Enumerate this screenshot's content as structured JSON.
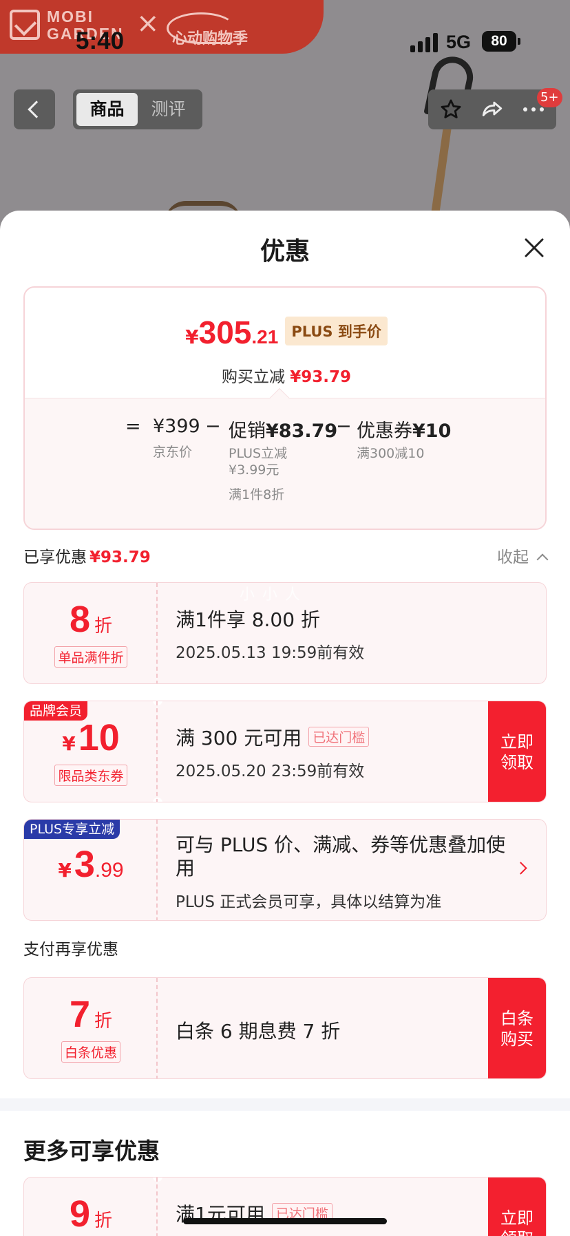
{
  "status_bar": {
    "time": "5:40",
    "network": "5G",
    "battery": "80"
  },
  "brand": {
    "name_line1": "MOBI",
    "name_line2": "GARDEN",
    "cross": "×",
    "campaign": "心动购物季"
  },
  "nav": {
    "tabs": [
      "商品",
      "测评"
    ],
    "active_tab": "商品",
    "badge": "5+"
  },
  "sheet": {
    "title": "优惠",
    "summary": {
      "currency": "¥",
      "price_int": "305",
      "price_dec": ".21",
      "price_tag": "PLUS 到手价",
      "reduce_label": "购买立减",
      "reduce_amount": "¥93.79",
      "eq": "=",
      "minus": "−",
      "jd_price": "¥399",
      "jd_price_label": "京东价",
      "promo_label": "促销",
      "promo_amount": "¥83.79",
      "promo_sub1": "PLUS立减",
      "promo_sub2": "¥3.99元",
      "promo_sub3": "满1件8折",
      "coupon_label": "优惠券",
      "coupon_amount": "¥10",
      "coupon_sub": "满300减10"
    },
    "enjoyed": {
      "label": "已享优惠",
      "amount": "¥93.79",
      "collapse_label": "收起"
    },
    "watermark": "小 小 人",
    "offers": [
      {
        "big": "8",
        "unit": "折",
        "tag": "单品满件折",
        "title": "满1件享 8.00 折",
        "subtitle": "2025.05.13 19:59前有效"
      },
      {
        "corner": "品牌会员",
        "currency": "¥",
        "big": "10",
        "tag": "限品类东券",
        "title": "满 300 元可用",
        "status": "已达门槛",
        "subtitle": "2025.05.20 23:59前有效",
        "button": "立即领取"
      },
      {
        "corner": "PLUS专享立减",
        "currency": "¥",
        "big": "3",
        "decimal": ".99",
        "title": "可与 PLUS 价、满减、券等优惠叠加使用",
        "subtitle": "PLUS 正式会员可享，具体以结算为准"
      }
    ],
    "pay_heading": "支付再享优惠",
    "pay_offer": {
      "big": "7",
      "unit": "折",
      "tag": "白条优惠",
      "title": "白条 6 期息费 7 折",
      "button": "白条购买"
    },
    "more_title": "更多可享优惠",
    "more_offer": {
      "big": "9",
      "unit": "折",
      "title": "满1元可用",
      "status": "已达门槛",
      "button": "立即领取"
    }
  },
  "colors": {
    "accent": "#f2202e",
    "plus_blue": "#2a3ba8",
    "card_bg": "#fdf5f6"
  }
}
